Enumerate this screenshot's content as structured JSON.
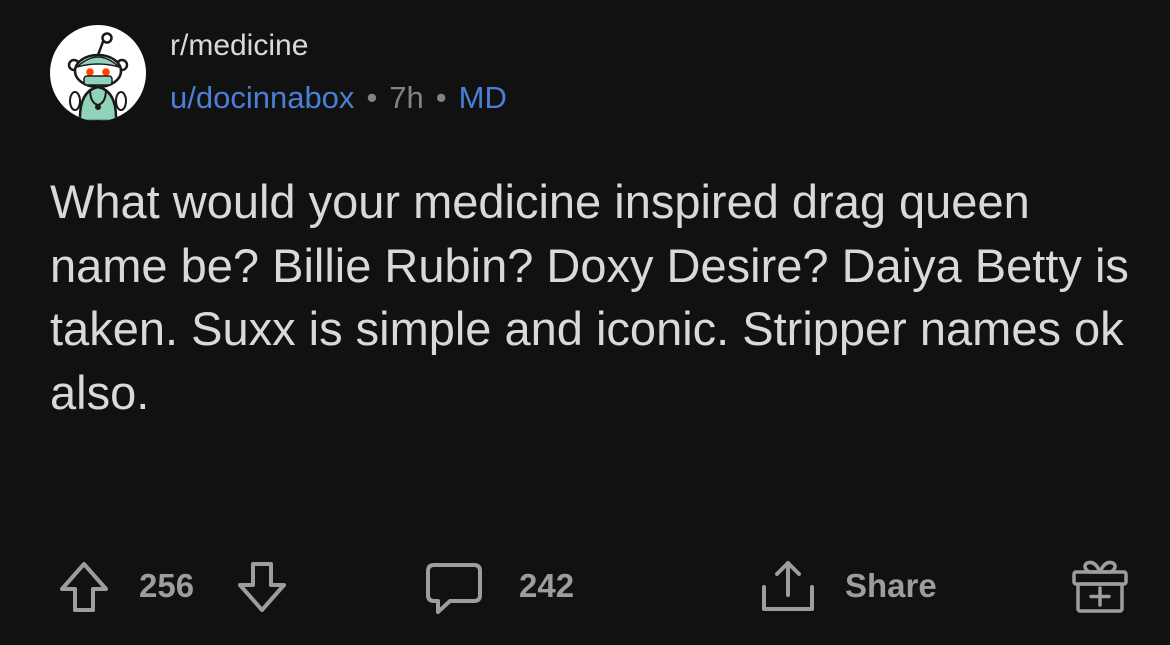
{
  "post": {
    "subreddit": "r/medicine",
    "author": "u/docinnabox",
    "separator": "•",
    "age": "7h",
    "flair": "MD",
    "body": "What would your medicine inspired drag queen name be? Billie Rubin? Doxy Desire? Daiya Betty is taken. Suxx is simple and iconic. Stripper names ok also."
  },
  "actions": {
    "score": "256",
    "comments": "242",
    "share_label": "Share"
  },
  "icons": {
    "avatar": "snoo-doctor-avatar",
    "upvote": "upvote-arrow-icon",
    "downvote": "downvote-arrow-icon",
    "comment": "comment-bubble-icon",
    "share": "share-icon",
    "award": "gift-award-icon"
  },
  "colors": {
    "background": "#111111",
    "text": "#d7dadc",
    "muted": "#9b9d9f",
    "link": "#4a7fd4"
  }
}
